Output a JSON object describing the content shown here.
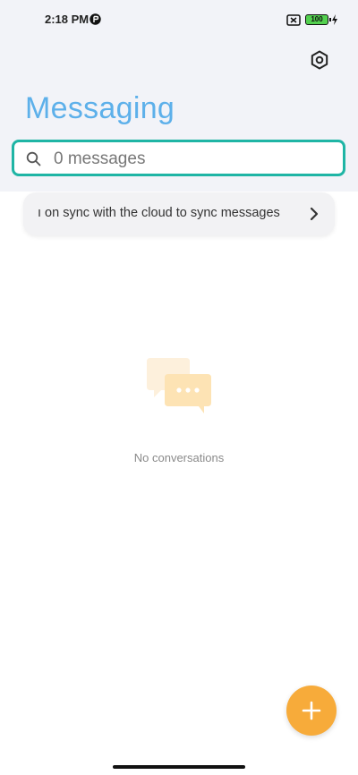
{
  "status_bar": {
    "time": "2:18 PM",
    "battery_level": "100",
    "icons": [
      "notification-icon",
      "sim-disabled-icon",
      "battery-icon",
      "charging-bolt-icon"
    ]
  },
  "header": {
    "title": "Messaging",
    "settings_icon": "gear-icon"
  },
  "search": {
    "placeholder": "0 messages",
    "value": "",
    "icon": "search-icon"
  },
  "sync_banner": {
    "text": "ı on sync with the cloud to sync messages",
    "icon": "chevron-right-icon"
  },
  "empty_state": {
    "icon": "chat-bubbles-icon",
    "text": "No conversations"
  },
  "fab": {
    "icon": "plus-icon"
  },
  "colors": {
    "title": "#5db0ea",
    "search_border": "#1fb5a5",
    "fab": "#f7ab3a",
    "header_bg": "#f2f3f8",
    "empty_illustration": "#fde3b4"
  }
}
